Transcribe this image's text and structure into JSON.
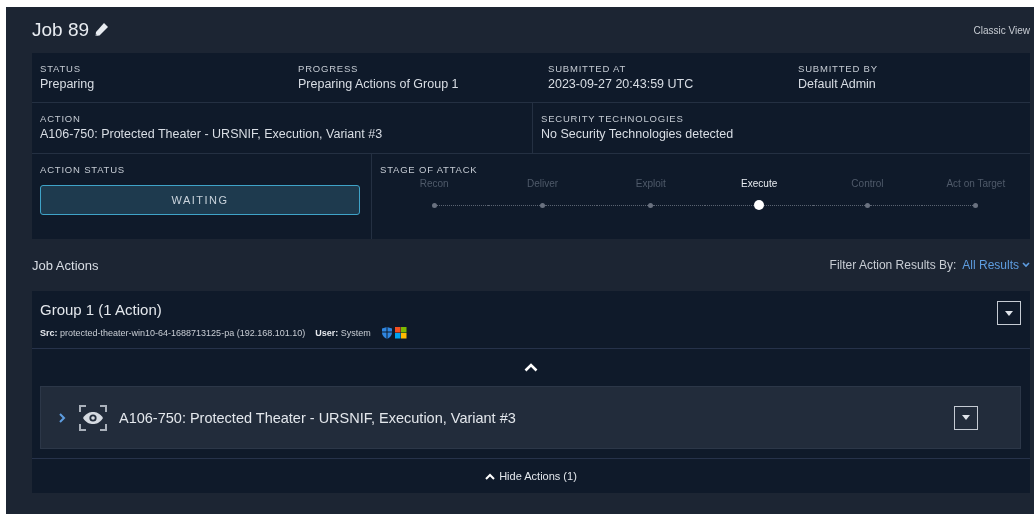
{
  "header": {
    "title": "Job 89",
    "classic_view": "Classic View"
  },
  "summary": {
    "top_fields": [
      {
        "label": "STATUS",
        "value": "Preparing"
      },
      {
        "label": "PROGRESS",
        "value": "Preparing Actions of Group 1"
      },
      {
        "label": "SUBMITTED AT",
        "value": "2023-09-27 20:43:59 UTC"
      },
      {
        "label": "SUBMITTED BY",
        "value": "Default Admin"
      }
    ],
    "mid_fields": [
      {
        "label": "ACTION",
        "value": "A106-750: Protected Theater - URSNIF, Execution, Variant #3"
      },
      {
        "label": "SECURITY TECHNOLOGIES",
        "value": "No Security Technologies detected"
      }
    ],
    "action_status": {
      "label": "ACTION STATUS",
      "value": "WAITING"
    },
    "stage_of_attack": {
      "label": "STAGE OF ATTACK",
      "stages": [
        {
          "label": "Recon",
          "selected": false
        },
        {
          "label": "Deliver",
          "selected": false
        },
        {
          "label": "Exploit",
          "selected": false
        },
        {
          "label": "Execute",
          "selected": true
        },
        {
          "label": "Control",
          "selected": false
        },
        {
          "label": "Act on Target",
          "selected": false
        }
      ]
    }
  },
  "job_actions": {
    "title": "Job Actions",
    "filter_label": "Filter Action Results By:",
    "filter_value": "All Results"
  },
  "group": {
    "title": "Group 1 (1 Action)",
    "src": "**Src:** protected-theater-win10-64-1688713125-pa (192.168.101.10)",
    "user": "**User:** System",
    "actions": [
      {
        "title": "A106-750: Protected Theater - URSNIF, Execution, Variant #3",
        "expanded": false
      }
    ],
    "hide_label": "Hide Actions (1)"
  }
}
